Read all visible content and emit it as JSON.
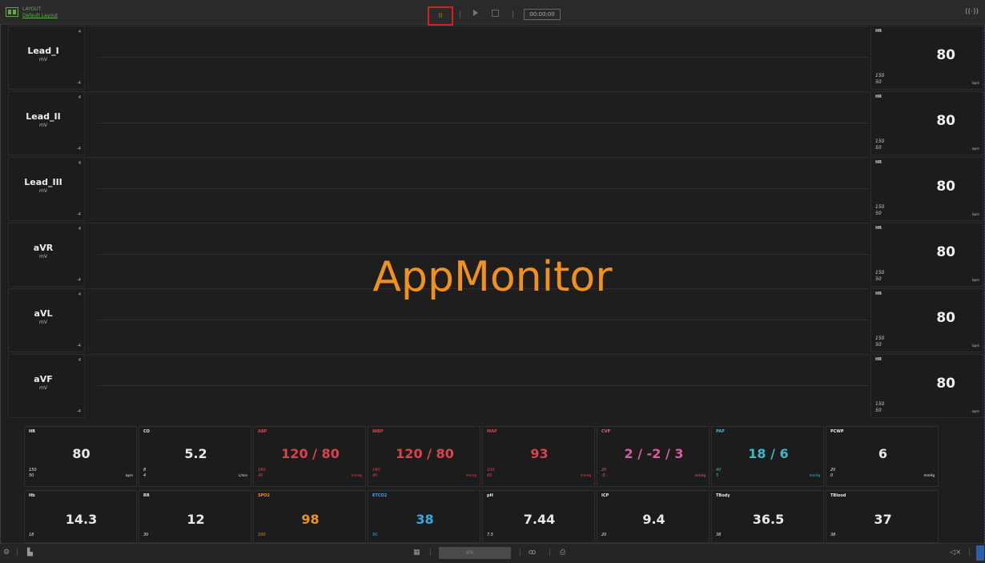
{
  "toolbar": {
    "layout_title": "LAYOUT",
    "layout_name": "Default Layout",
    "pause_label": "II",
    "time_display": "00:00:00",
    "signal_icon": "antenna-signal-icon"
  },
  "leads": [
    {
      "name": "Lead_I",
      "unit": "mV",
      "max": "4",
      "min": "-4"
    },
    {
      "name": "Lead_II",
      "unit": "mV",
      "max": "4",
      "min": "-4"
    },
    {
      "name": "Lead_III",
      "unit": "mV",
      "max": "4",
      "min": "-4"
    },
    {
      "name": "aVR",
      "unit": "mV",
      "max": "4",
      "min": "-4"
    },
    {
      "name": "aVL",
      "unit": "mV",
      "max": "4",
      "min": "-4"
    },
    {
      "name": "aVF",
      "unit": "mV",
      "max": "4",
      "min": "-4"
    }
  ],
  "hr_panel": {
    "label": "HR",
    "value": "80",
    "high": "150",
    "low": "50",
    "unit": "bpm"
  },
  "watermark": "AppMonitor",
  "numerics_row1": [
    {
      "label": "HR",
      "value": "80",
      "high": "150",
      "low": "50",
      "unit": "bpm",
      "color": "#e8e8e8"
    },
    {
      "label": "CO",
      "value": "5.2",
      "high": "8",
      "low": "4",
      "unit": "L/min",
      "color": "#e8e8e8"
    },
    {
      "label": "ABP",
      "value": "120 / 80",
      "high": "160",
      "low": "40",
      "unit": "mmHg",
      "color": "#d9434f"
    },
    {
      "label": "NIBP",
      "value": "120 / 80",
      "high": "160",
      "low": "40",
      "unit": "mmHg",
      "color": "#d9434f"
    },
    {
      "label": "MAP",
      "value": "93",
      "high": "100",
      "low": "60",
      "unit": "mmHg",
      "color": "#d9434f"
    },
    {
      "label": "CVP",
      "value": "2 / -2 / 3",
      "high": "20",
      "low": "-5",
      "unit": "mmHg",
      "color": "#d65fa0"
    },
    {
      "label": "PAP",
      "value": "18 / 6",
      "high": "40",
      "low": "5",
      "unit": "mmHg",
      "color": "#3fb7c7"
    },
    {
      "label": "PCWP",
      "value": "6",
      "high": "20",
      "low": "0",
      "unit": "mmHg",
      "color": "#e8e8e8"
    }
  ],
  "numerics_row2": [
    {
      "label": "Hb",
      "value": "14.3",
      "high": "18",
      "color": "#e8e8e8"
    },
    {
      "label": "RR",
      "value": "12",
      "high": "30",
      "color": "#e8e8e8"
    },
    {
      "label": "SPO2",
      "value": "98",
      "high": "100",
      "color": "#f0901e"
    },
    {
      "label": "ETCO2",
      "value": "38",
      "high": "50",
      "color": "#3aa8e0"
    },
    {
      "label": "pH",
      "value": "7.44",
      "high": "7.5",
      "color": "#e8e8e8"
    },
    {
      "label": "ICP",
      "value": "9.4",
      "high": "20",
      "color": "#e8e8e8"
    },
    {
      "label": "TBody",
      "value": "36.5",
      "high": "38",
      "color": "#e8e8e8"
    },
    {
      "label": "TBlood",
      "value": "37",
      "high": "38",
      "color": "#e8e8e8"
    }
  ],
  "bottombar": {
    "zoom_value": "6%"
  }
}
